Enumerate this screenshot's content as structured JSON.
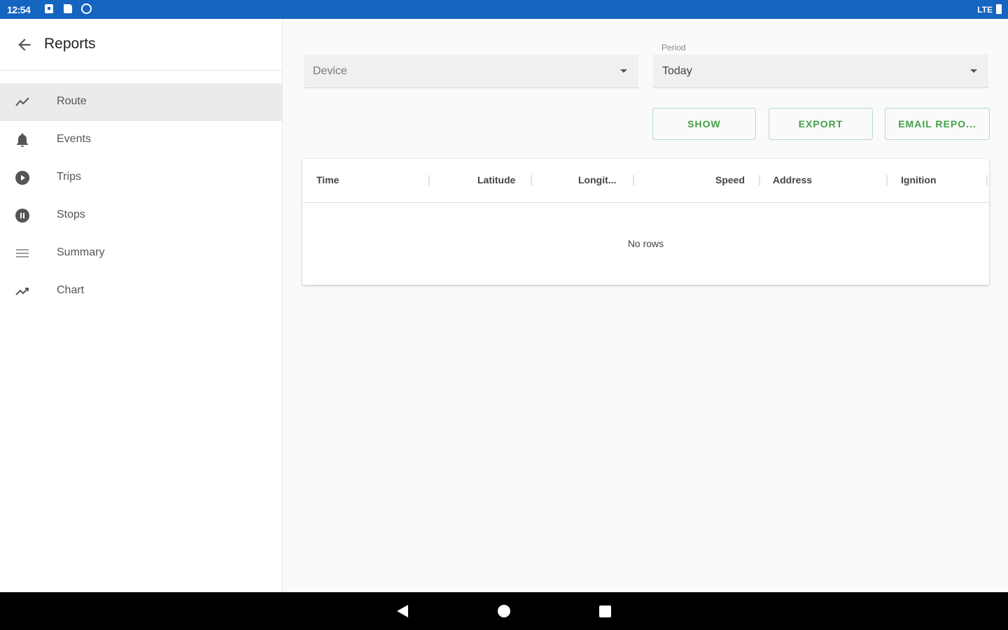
{
  "status_bar": {
    "time": "12:54",
    "network": "LTE"
  },
  "sidebar": {
    "title": "Reports",
    "items": [
      {
        "label": "Route",
        "icon": "route-icon",
        "active": true
      },
      {
        "label": "Events",
        "icon": "bell-icon",
        "active": false
      },
      {
        "label": "Trips",
        "icon": "play-circle-icon",
        "active": false
      },
      {
        "label": "Stops",
        "icon": "pause-circle-icon",
        "active": false
      },
      {
        "label": "Summary",
        "icon": "list-icon",
        "active": false
      },
      {
        "label": "Chart",
        "icon": "trending-up-icon",
        "active": false
      }
    ]
  },
  "filters": {
    "device_placeholder": "Device",
    "period_label": "Period",
    "period_value": "Today"
  },
  "actions": {
    "show": "SHOW",
    "export": "EXPORT",
    "email": "EMAIL REPO..."
  },
  "table": {
    "columns": [
      "Time",
      "Latitude",
      "Longit...",
      "Speed",
      "Address",
      "Ignition"
    ],
    "empty_text": "No rows"
  },
  "colors": {
    "status_bar": "#1565c0",
    "accent": "#43a047",
    "active_row": "#ebebeb"
  }
}
